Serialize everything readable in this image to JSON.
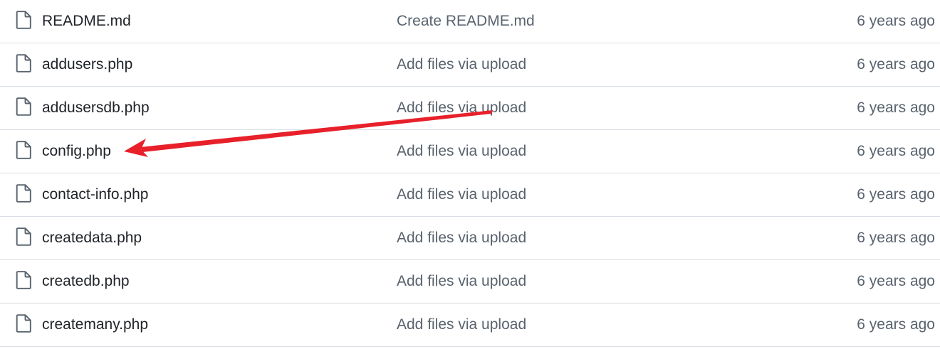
{
  "files": [
    {
      "name": "README.md",
      "message": "Create README.md",
      "age": "6 years ago",
      "icon": "file-icon"
    },
    {
      "name": "addusers.php",
      "message": "Add files via upload",
      "age": "6 years ago",
      "icon": "file-icon"
    },
    {
      "name": "addusersdb.php",
      "message": "Add files via upload",
      "age": "6 years ago",
      "icon": "file-icon"
    },
    {
      "name": "config.php",
      "message": "Add files via upload",
      "age": "6 years ago",
      "icon": "file-icon"
    },
    {
      "name": "contact-info.php",
      "message": "Add files via upload",
      "age": "6 years ago",
      "icon": "file-icon"
    },
    {
      "name": "createdata.php",
      "message": "Add files via upload",
      "age": "6 years ago",
      "icon": "file-icon"
    },
    {
      "name": "createdb.php",
      "message": "Add files via upload",
      "age": "6 years ago",
      "icon": "file-icon"
    },
    {
      "name": "createmany.php",
      "message": "Add files via upload",
      "age": "6 years ago",
      "icon": "file-icon"
    }
  ],
  "annotation": {
    "type": "arrow",
    "color": "#e8202a",
    "points_to": "config.php"
  }
}
